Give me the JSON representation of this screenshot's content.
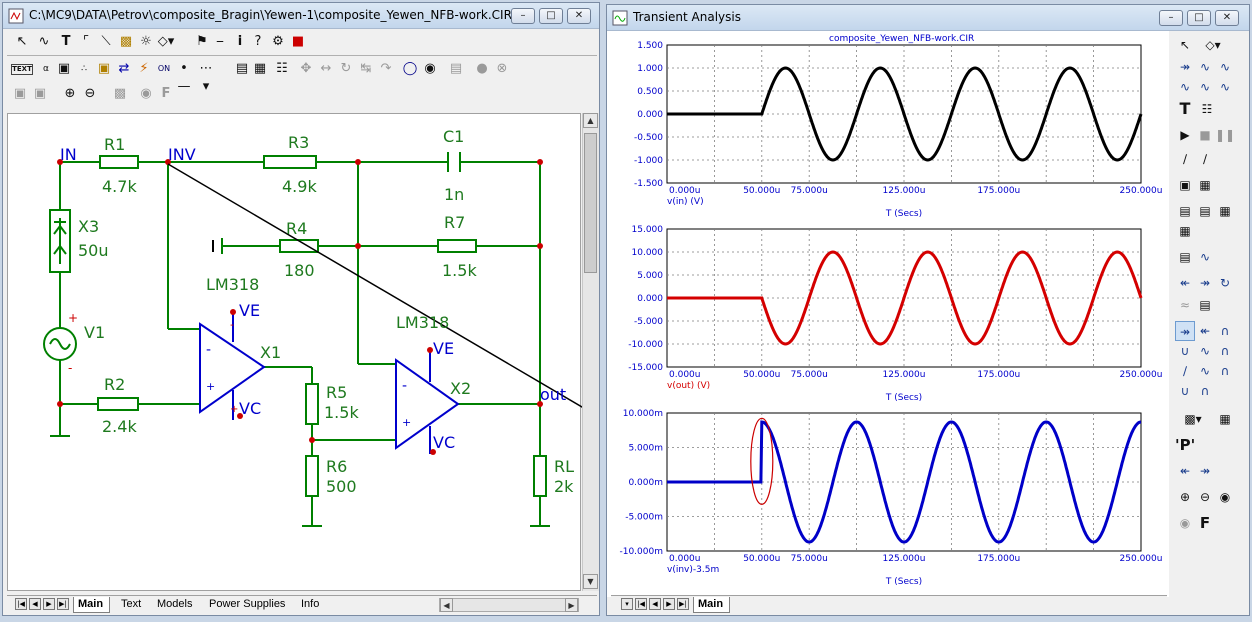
{
  "schematic": {
    "title": "C:\\MC9\\DATA\\Petrov\\composite_Bragin\\Yewen-1\\composite_Yewen_NFB-work.CIR",
    "tabs": [
      "Main",
      "Text",
      "Models",
      "Power Supplies",
      "Info"
    ],
    "nodes": {
      "in": "IN",
      "inv": "INV",
      "out": "out",
      "ve1": "VE",
      "vc1": "VC",
      "ve2": "VE",
      "vc2": "VC"
    },
    "components": {
      "r1": {
        "name": "R1",
        "value": "4.7k"
      },
      "r2": {
        "name": "R2",
        "value": "2.4k"
      },
      "r3": {
        "name": "R3",
        "value": "4.9k"
      },
      "r4": {
        "name": "R4",
        "value": "180"
      },
      "r5": {
        "name": "R5",
        "value": "1.5k"
      },
      "r6": {
        "name": "R6",
        "value": "500"
      },
      "r7": {
        "name": "R7",
        "value": "1.5k"
      },
      "rl": {
        "name": "RL",
        "value": "2k"
      },
      "c1": {
        "name": "C1",
        "value": "1n"
      },
      "x3": {
        "name": "X3",
        "value": "50u"
      },
      "v1": {
        "name": "V1"
      },
      "x1": {
        "name": "X1",
        "model": "LM318"
      },
      "x2": {
        "name": "X2",
        "model": "LM318"
      }
    },
    "colors": {
      "wire": "#008000",
      "label": "#1f7a1f",
      "node": "#0000cc",
      "pin": "#cc0000"
    }
  },
  "analysis": {
    "title": "Transient Analysis",
    "plot_header": "composite_Yewen_NFB-work.CIR",
    "tabs": [
      "Main"
    ],
    "x_ticks": [
      "0.000u",
      "50.000u",
      "75.000u",
      "125.000u",
      "175.000u",
      "250.000u"
    ],
    "x_title": "T (Secs)",
    "plots": [
      {
        "expr": "v(in) (V)",
        "color": "#000000",
        "y_ticks": [
          "1.500",
          "1.000",
          "0.500",
          "0.000",
          "-0.500",
          "-1.000",
          "-1.500"
        ]
      },
      {
        "expr": "v(out) (V)",
        "color": "#d40000",
        "y_ticks": [
          "15.000",
          "10.000",
          "5.000",
          "0.000",
          "-5.000",
          "-10.000",
          "-15.000"
        ]
      },
      {
        "expr": "v(inv)-3.5m",
        "color": "#0000c8",
        "y_ticks": [
          "10.000m",
          "5.000m",
          "0.000m",
          "-5.000m",
          "-10.000m"
        ]
      }
    ]
  },
  "chart_data": [
    {
      "type": "line",
      "xlabel": "T (Secs)",
      "ylabel": "v(in) (V)",
      "xlim": [
        0,
        250
      ],
      "ylim": [
        -1.5,
        1.5
      ],
      "series": [
        {
          "name": "v(in) (V)",
          "shape": "sine",
          "start": 50,
          "period": 50,
          "amplitude": 1.0,
          "offset": 0,
          "phase": "sin"
        }
      ]
    },
    {
      "type": "line",
      "xlabel": "T (Secs)",
      "ylabel": "v(out) (V)",
      "xlim": [
        0,
        250
      ],
      "ylim": [
        -15,
        15
      ],
      "series": [
        {
          "name": "v(out) (V)",
          "shape": "sine",
          "start": 50,
          "period": 50,
          "amplitude": -10.0,
          "offset": 0,
          "phase": "sin"
        }
      ]
    },
    {
      "type": "line",
      "xlabel": "T (Secs)",
      "ylabel": "v(inv)-3.5m",
      "xlim": [
        0,
        250
      ],
      "ylim": [
        -10,
        10
      ],
      "series": [
        {
          "name": "v(inv)-3.5m",
          "shape": "cos",
          "start": 50,
          "period": 50,
          "amplitude": 8.7,
          "offset": 0,
          "step_to": 9.0,
          "phase": "cos"
        }
      ]
    }
  ]
}
